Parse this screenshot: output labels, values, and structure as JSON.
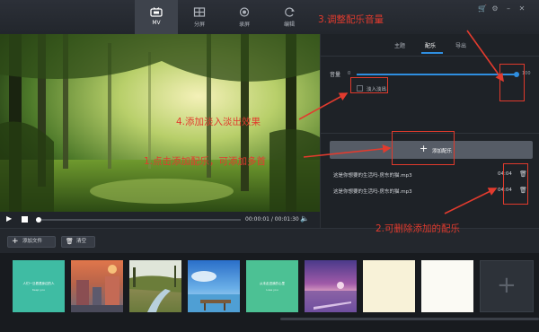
{
  "nav": {
    "tabs": [
      {
        "label": "MV",
        "icon": "tv-icon",
        "active": true
      },
      {
        "label": "分屏",
        "icon": "split-screen-icon",
        "active": false
      },
      {
        "label": "录屏",
        "icon": "record-icon",
        "active": false
      },
      {
        "label": "编辑",
        "icon": "refresh-edit-icon",
        "active": false
      }
    ]
  },
  "player": {
    "time": "00:00:01 / 00:01:30",
    "progress": 0.01
  },
  "panel": {
    "tabs": [
      "主题",
      "配乐",
      "导出"
    ],
    "active_tab": "配乐",
    "volume_label": "音量",
    "volume_min": "0",
    "volume_max": "100",
    "volume_value": 100,
    "fade_label": "淡入淡出",
    "add_music_label": "添加配乐",
    "tracks": [
      {
        "name": "这是你想要的生活吗-房东的猫.mp3",
        "duration": "04:04"
      },
      {
        "name": "这是你想要的生活吗-房东的猫.mp3",
        "duration": "04:04"
      }
    ]
  },
  "toolbar": {
    "add_file_label": "添加文件",
    "clear_label": "清空"
  },
  "annotations": {
    "a1": "1.点击添加配乐，可添加多首",
    "a2": "2.可删除添加的配乐",
    "a3": "3.调整配乐音量",
    "a4": "4.添加淡入淡出效果"
  },
  "thumbnails": [
    {
      "kind": "teal-text",
      "line1": "人们一旦看透身边的人",
      "line2": "Keep you"
    },
    {
      "kind": "illustration-town"
    },
    {
      "kind": "river-photo"
    },
    {
      "kind": "pier-photo"
    },
    {
      "kind": "green-text",
      "line1": "从未走进我的心里",
      "line2": "Lose you"
    },
    {
      "kind": "purple-sunset"
    },
    {
      "kind": "blank-cream"
    },
    {
      "kind": "blank-white"
    }
  ],
  "colors": {
    "accent_blue": "#2f8ee0",
    "annotation_red": "#e23b2e"
  }
}
